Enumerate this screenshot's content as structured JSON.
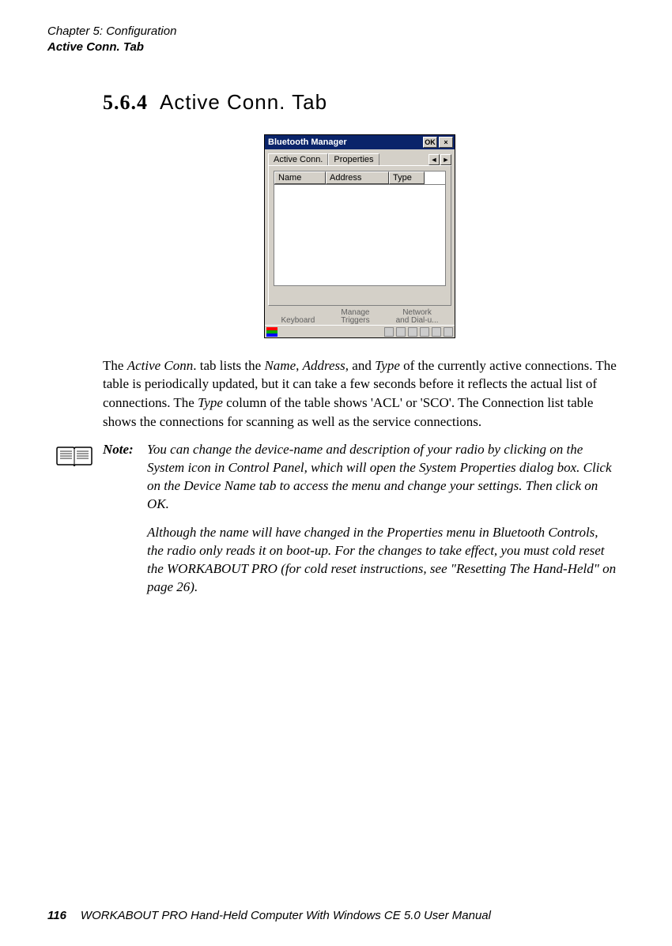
{
  "header": {
    "chapter": "Chapter 5: Configuration",
    "section": "Active Conn. Tab"
  },
  "heading": {
    "number": "5.6.4",
    "title": "Active Conn. Tab"
  },
  "screenshot": {
    "title": "Bluetooth Manager",
    "ok": "OK",
    "close": "×",
    "tabs": {
      "active": "Active Conn.",
      "properties": "Properties",
      "navLeft": "◄",
      "navRight": "►"
    },
    "columns": {
      "name": "Name",
      "address": "Address",
      "type": "Type"
    },
    "bottomIcons": {
      "keyboard": "Keyboard",
      "manage1": "Manage",
      "manage2": "Triggers",
      "network1": "Network",
      "network2": "and Dial-u..."
    }
  },
  "paragraph": {
    "p1a": "The ",
    "p1b": "Active Conn",
    "p1c": ". tab lists the ",
    "p1d": "Name",
    "p1e": ", ",
    "p1f": "Address",
    "p1g": ", and ",
    "p1h": "Type",
    "p1i": " of the currently active connections. The table is periodically updated, but it can take a few seconds before it reflects the actual list of connections. The ",
    "p1j": "Type",
    "p1k": " column of the table shows 'ACL' or 'SCO'. The Connection list table shows the connections for scanning as well as the service connections."
  },
  "note": {
    "label": "Note:",
    "body1": "You can change the device-name and description of your radio by clicking on the System icon in Control Panel, which will open the System Properties dialog box. Click on the Device Name tab to access the menu and change your settings. Then click on OK.",
    "body2a": "Although the name will have changed in the Properties menu in ",
    "body2b": "Bluetooth Controls",
    "body2c": ", the radio only reads it on boot-up. For the changes to take effect, you must cold reset the WORKABOUT PRO (for cold reset instructions, see \"Resetting The Hand-Held\" on page 26)."
  },
  "footer": {
    "page": "116",
    "text": "WORKABOUT PRO Hand-Held Computer With Windows CE 5.0 User Manual"
  }
}
